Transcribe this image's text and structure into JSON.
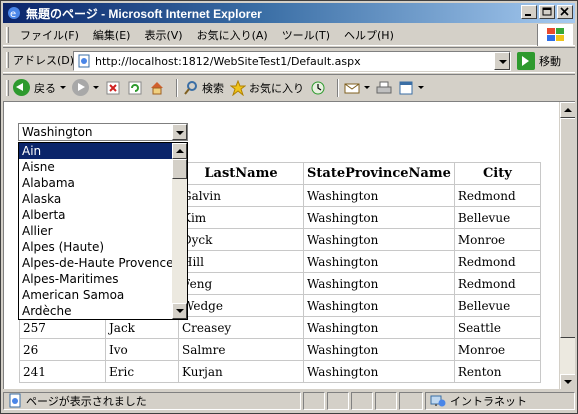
{
  "window": {
    "title": "無題のページ - Microsoft Internet Explorer"
  },
  "menu": {
    "items": [
      "ファイル(F)",
      "編集(E)",
      "表示(V)",
      "お気に入り(A)",
      "ツール(T)",
      "ヘルプ(H)"
    ]
  },
  "address": {
    "label": "アドレス(D)",
    "url": "http://localhost:1812/WebSiteTest1/Default.aspx",
    "go_label": "移動"
  },
  "toolbar": {
    "back_label": "戻る",
    "search_label": "検索",
    "favorites_label": "お気に入り"
  },
  "dropdown": {
    "selected": "Washington",
    "options": [
      "Ain",
      "Aisne",
      "Alabama",
      "Alaska",
      "Alberta",
      "Allier",
      "Alpes (Haute)",
      "Alpes-de-Haute Provence",
      "Alpes-Maritimes",
      "American Samoa",
      "Ardèche"
    ],
    "highlighted": "Ain"
  },
  "grid": {
    "headers": [
      "",
      "",
      "LastName",
      "StateProvinceName",
      "City"
    ],
    "rows": [
      [
        "",
        "",
        "Galvin",
        "Washington",
        "Redmond"
      ],
      [
        "",
        "",
        "Kim",
        "Washington",
        "Bellevue"
      ],
      [
        "",
        "",
        "Dyck",
        "Washington",
        "Monroe"
      ],
      [
        "",
        "",
        "Hill",
        "Washington",
        "Redmond"
      ],
      [
        "",
        "",
        "Feng",
        "Washington",
        "Redmond"
      ],
      [
        "",
        "",
        "Wedge",
        "Washington",
        "Bellevue"
      ],
      [
        "257",
        "Jack",
        "Creasey",
        "Washington",
        "Seattle"
      ],
      [
        "26",
        "Ivo",
        "Salmre",
        "Washington",
        "Monroe"
      ],
      [
        "241",
        "Eric",
        "Kurjan",
        "Washington",
        "Renton"
      ]
    ]
  },
  "status": {
    "text": "ページが表示されました",
    "zone": "イントラネット"
  },
  "colors": {
    "titlebar_start": "#0a246a",
    "titlebar_end": "#a6caf0",
    "selection": "#0a246a"
  }
}
